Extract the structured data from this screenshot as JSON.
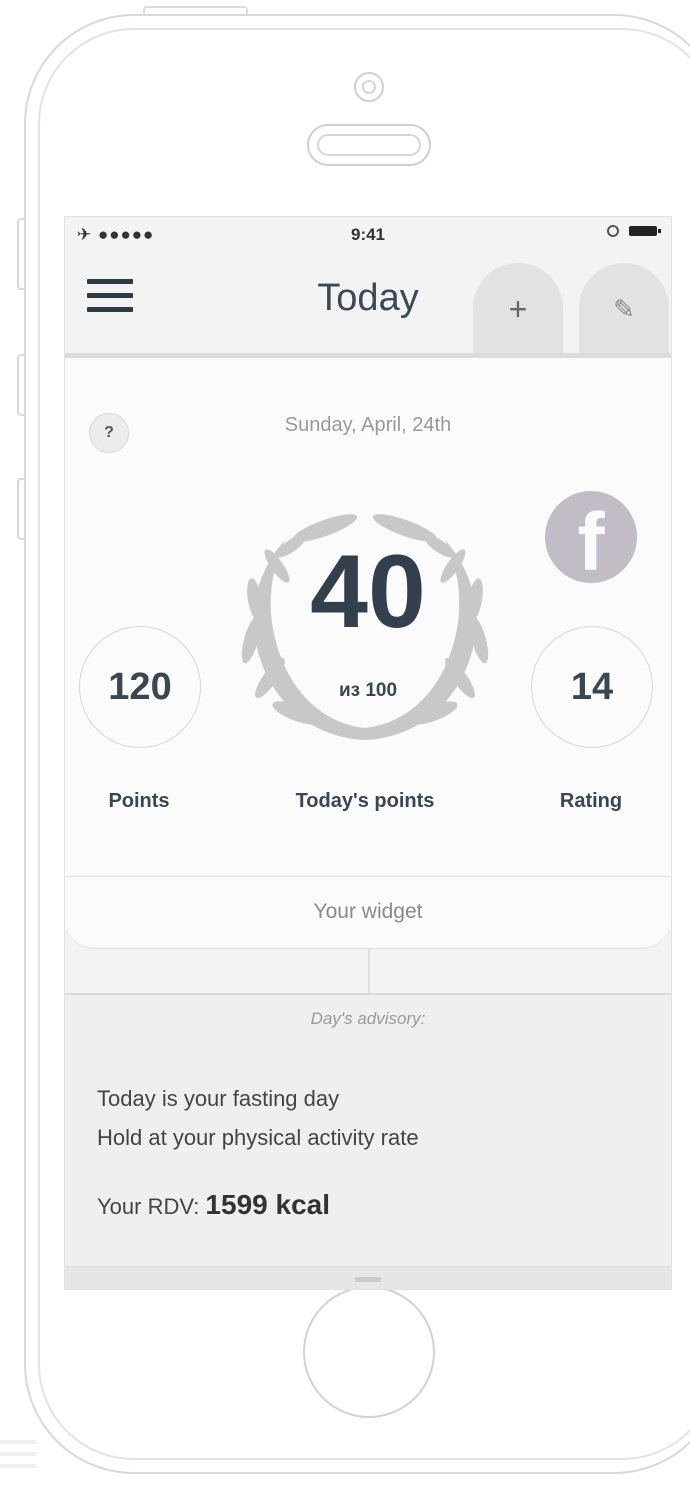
{
  "status_bar": {
    "carrier": "✈ ●●●●● ",
    "time": "9:41"
  },
  "nav": {
    "title": "Today",
    "add_label": "+",
    "edit_label": "✎"
  },
  "summary": {
    "date": "Sunday, April, 24th",
    "help_label": "?",
    "facebook_label": "f",
    "points_value": "120",
    "points_label": "Points",
    "today_value": "40",
    "today_of": "из 100",
    "today_label": "Today's points",
    "rating_value": "14",
    "rating_label": "Rating",
    "widget_label": "Your widget"
  },
  "advisory": {
    "title": "Day's advisory:",
    "line1": "Today is your fasting day",
    "line2": "Hold at your physical activity rate",
    "rdv_label": "Your RDV: ",
    "rdv_value": "1599 kcal"
  },
  "colors": {
    "accent_dark": "#333f4c",
    "facebook_grey": "#c1bcc6"
  }
}
